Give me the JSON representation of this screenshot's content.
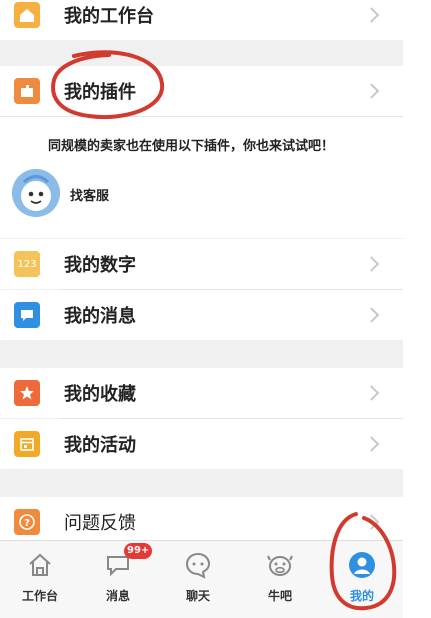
{
  "menu": {
    "workbench": "我的工作台",
    "plugins": "我的插件",
    "numbers": "我的数字",
    "messages": "我的消息",
    "favorites": "我的收藏",
    "activities": "我的活动",
    "feedback": "问题反馈"
  },
  "recommend": {
    "text": "同规模的卖家也在使用以下插件，你也来试试吧！",
    "item": "找客服"
  },
  "numbers_icon_text": "123",
  "tabbar": {
    "tabs": [
      {
        "label": "工作台"
      },
      {
        "label": "消息",
        "badge": "99+"
      },
      {
        "label": "聊天"
      },
      {
        "label": "牛吧"
      },
      {
        "label": "我的"
      }
    ]
  },
  "colors": {
    "orange": "#f08a3e",
    "yellow": "#f6c35a",
    "blue": "#2f8fe0",
    "red": "#d33a2f"
  }
}
